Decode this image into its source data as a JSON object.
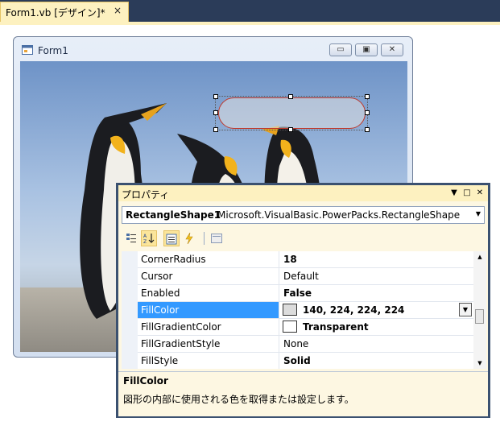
{
  "document_tab": {
    "label": "Form1.vb [デザイン]*",
    "close": "×"
  },
  "form": {
    "title": "Form1",
    "buttons": {
      "minimize": "▭",
      "maximize": "▣",
      "close": "✕"
    }
  },
  "properties_window": {
    "title": "プロパティ",
    "title_buttons": {
      "dropdown": "▼",
      "restore": "□",
      "close": "✕"
    },
    "object_name": "RectangleShape1",
    "object_type": "Microsoft.VisualBasic.PowerPacks.RectangleShape",
    "rows": [
      {
        "name": "CornerRadius",
        "value": "18",
        "bold": true
      },
      {
        "name": "Cursor",
        "value": "Default",
        "bold": false
      },
      {
        "name": "Enabled",
        "value": "False",
        "bold": true
      },
      {
        "name": "FillColor",
        "value": "140, 224, 224, 224",
        "bold": true,
        "selected": true,
        "swatch": "#dcdcdc"
      },
      {
        "name": "FillGradientColor",
        "value": "Transparent",
        "bold": true,
        "swatch": "#ffffff"
      },
      {
        "name": "FillGradientStyle",
        "value": "None",
        "bold": false
      },
      {
        "name": "FillStyle",
        "value": "Solid",
        "bold": true
      }
    ],
    "description": {
      "title": "FillColor",
      "text": "図形の内部に使用される色を取得または設定します。"
    }
  },
  "colors": {
    "tab_bar": "#2b3c59",
    "tab_active": "#fdf1c0",
    "selection": "#3399ff",
    "shape_border": "#c0392b"
  }
}
